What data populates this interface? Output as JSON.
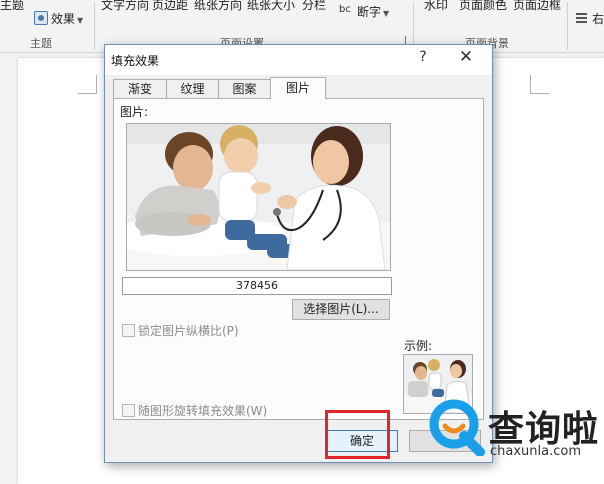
{
  "ribbon": {
    "items": [
      "主题",
      "效果",
      "文字方向",
      "页边距",
      "纸张方向",
      "纸张大小",
      "分栏",
      "断字",
      "水印",
      "页面颜色",
      "页面边框",
      "右"
    ],
    "groups": [
      "主题",
      "页面设置",
      "页面背景"
    ]
  },
  "dialog": {
    "title": "填充效果",
    "help_glyph": "?",
    "close_glyph": "✕",
    "tabs": [
      "渐变",
      "纹理",
      "图案",
      "图片"
    ],
    "active_tab": "图片",
    "picture_label": "图片:",
    "picture_name": "378456",
    "select_picture_label": "选择图片(L)...",
    "lock_aspect_label": "锁定图片纵横比(P)",
    "lock_aspect_checked": false,
    "rotate_with_shape_label": "随图形旋转填充效果(W)",
    "rotate_with_shape_checked": false,
    "sample_label": "示例:",
    "ok_label": "确定",
    "cancel_label": ""
  },
  "watermark": {
    "chinese": "查询啦",
    "url": "chaxunla.com"
  },
  "colors": {
    "dialog_border": "#6f8fb8",
    "highlight_box": "#e0262c",
    "watermark_blue": "#1aa0e8",
    "watermark_orange": "#f08a1c"
  }
}
